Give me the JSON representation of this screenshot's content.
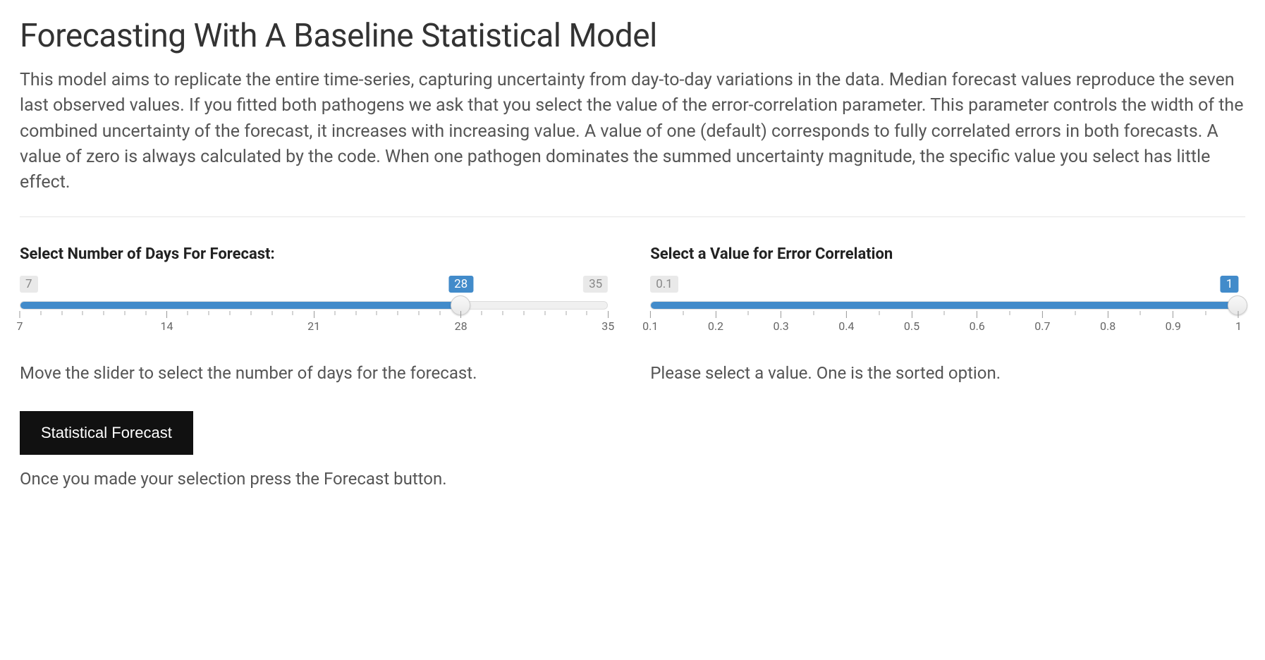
{
  "title": "Forecasting With A Baseline Statistical Model",
  "intro": "This model aims to replicate the entire time-series, capturing uncertainty from day-to-day variations in the data. Median forecast values reproduce the seven last observed values. If you fitted both pathogens we ask that you select the value of the error-correlation parameter. This parameter controls the width of the combined uncertainty of the forecast, it increases with increasing value. A value of one (default) corresponds to fully correlated errors in both forecasts. A value of zero is always calculated by the code. When one pathogen dominates the summed uncertainty magnitude, the specific value you select has little effect.",
  "slider1": {
    "label": "Select Number of Days For Forecast:",
    "min": 7,
    "max": 35,
    "value": 28,
    "min_text": "7",
    "max_text": "35",
    "value_text": "28",
    "ticks_major": [
      7,
      14,
      21,
      28,
      35
    ],
    "ticks_major_labels": [
      "7",
      "14",
      "21",
      "28",
      "35"
    ],
    "ticks_all": [
      7,
      8,
      9,
      10,
      11,
      12,
      13,
      14,
      15,
      16,
      17,
      18,
      19,
      20,
      21,
      22,
      23,
      24,
      25,
      26,
      27,
      28,
      29,
      30,
      31,
      32,
      33,
      34,
      35
    ],
    "help": "Move the slider to select the number of days for the forecast."
  },
  "slider2": {
    "label": "Select a Value for Error Correlation",
    "min": 0.1,
    "max": 1,
    "value": 1,
    "min_text": "0.1",
    "max_text": "1",
    "value_text": "1",
    "ticks_major": [
      0.1,
      0.2,
      0.3,
      0.4,
      0.5,
      0.6,
      0.7,
      0.8,
      0.9,
      1
    ],
    "ticks_major_labels": [
      "0.1",
      "0.2",
      "0.3",
      "0.4",
      "0.5",
      "0.6",
      "0.7",
      "0.8",
      "0.9",
      "1"
    ],
    "ticks_all": [
      0.1,
      0.15,
      0.2,
      0.25,
      0.3,
      0.35,
      0.4,
      0.45,
      0.5,
      0.55,
      0.6,
      0.65,
      0.7,
      0.75,
      0.8,
      0.85,
      0.9,
      0.95,
      1
    ],
    "help": "Please select a value. One is the sorted option."
  },
  "button_label": "Statistical Forecast",
  "footer": "Once you made your selection press the Forecast button."
}
